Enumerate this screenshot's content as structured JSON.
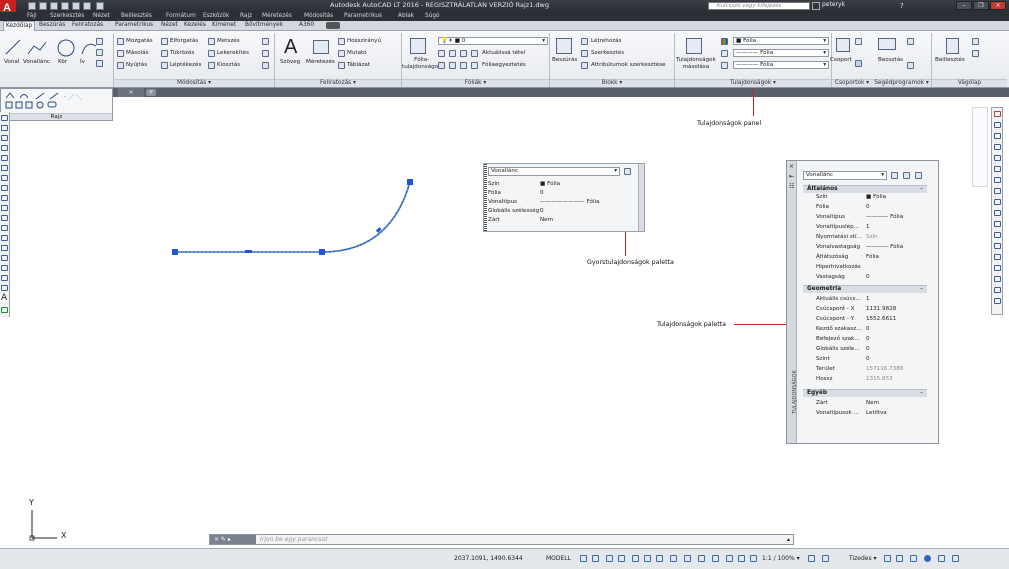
{
  "window": {
    "title": "Autodesk AutoCAD LT 2016 - REGISZTRÁLATLAN VERZIÓ   Rajz1.dwg",
    "app_button": "A",
    "search_placeholder": "Kulcsszó vagy kifejezés",
    "user": "peteryk",
    "minimize": "–",
    "restore": "❐",
    "close": "×"
  },
  "menu": [
    "Fájl",
    "Szerkesztés",
    "Nézet",
    "Beillesztés",
    "Formátum",
    "Eszközök",
    "Rajz",
    "Méretezés",
    "Módosítás",
    "Parametrikus",
    "Ablak",
    "Súgó"
  ],
  "ribbon_tabs": [
    "Kezdőlap",
    "Beszúrás",
    "Feliratozás",
    "Parametrikus",
    "Nézet",
    "Kezelés",
    "Kimenet",
    "Bővítmények",
    "A360"
  ],
  "ribbon": {
    "rajz": {
      "vonal": "Vonal",
      "vonallanc": "Vonallánc",
      "kor": "Kör",
      "iv": "Ív"
    },
    "modositas": {
      "title": "Módosítás",
      "mozgatas": "Mozgatás",
      "elforgatas": "Elforgatás",
      "metszes": "Metszés",
      "masolas": "Másolás",
      "tukrozes": "Tükrözés",
      "lekerekites": "Lekerekítés",
      "nyujtas": "Nyújtás",
      "leptekezes": "Léptékezés",
      "kiosztas": "Kiosztás"
    },
    "feliratozas": {
      "title": "Feliratozás",
      "szoveg": "Szöveg",
      "meretezes": "Méretezés",
      "hosszirany": "Hosszirányú",
      "mutato": "Mutató",
      "tablazat": "Táblázat"
    },
    "foliak": {
      "title": "Fóliák",
      "folia_tul": "Fólia-\ntulajdonságok",
      "current_layer": "0",
      "aktualissa": "Aktuálissá tétel",
      "foliaegy": "Fóliaegyeztetés"
    },
    "blokk": {
      "title": "Blokk",
      "beszuras": "Beszúrás",
      "letrehozas": "Létrehozás",
      "szerkesztes": "Szerkesztés",
      "attributumok": "Attribútumok szerkesztése"
    },
    "tulajdonsagok": {
      "title": "Tulajdonságok",
      "masolas": "Tulajdonságok\nmásolása",
      "color": "Fólia",
      "linetype": "Fólia",
      "lineweight": "Fólia"
    },
    "csoportok": {
      "title": "Csoportok",
      "csoport": "Csoport"
    },
    "segedprogramok": {
      "title": "Segédprogramok",
      "beosztas": "Beosztás"
    },
    "vagolap": {
      "title": "Vágólap",
      "beillesztes": "Beillesztés"
    }
  },
  "rajz_panel_title": "Rajz",
  "doc_tab": "×",
  "doc_tab_plus": "+",
  "quick_props": {
    "type": "Vonallánc",
    "rows": [
      {
        "label": "Szín",
        "value": "Fólia"
      },
      {
        "label": "Fólia",
        "value": "0"
      },
      {
        "label": "Vonaltípus",
        "value": "Fólia"
      },
      {
        "label": "Globális szélesség",
        "value": "0"
      },
      {
        "label": "Zárt",
        "value": "Nem"
      }
    ]
  },
  "properties_palette": {
    "type": "Vonallánc",
    "side_title": "TULAJDONSÁGOK",
    "categories": [
      {
        "name": "Általános",
        "rows": [
          {
            "label": "Szín",
            "value": "Fólia"
          },
          {
            "label": "Fólia",
            "value": "0"
          },
          {
            "label": "Vonaltípus",
            "value": "Fólia"
          },
          {
            "label": "Vonaltípuslép...",
            "value": "1"
          },
          {
            "label": "Nyomtatási stí...",
            "value": "Szín"
          },
          {
            "label": "Vonalvastagság",
            "value": "Fólia"
          },
          {
            "label": "Átlátszóság",
            "value": "Fólia"
          },
          {
            "label": "Hiperhivatkozás",
            "value": ""
          },
          {
            "label": "Vastagság",
            "value": "0"
          }
        ]
      },
      {
        "name": "Geometria",
        "rows": [
          {
            "label": "Aktuális csúcs...",
            "value": "1"
          },
          {
            "label": "Csúcspont - X",
            "value": "1131.9828"
          },
          {
            "label": "Csúcspont - Y",
            "value": "1552.6611"
          },
          {
            "label": "Kezdő szakasz...",
            "value": "0"
          },
          {
            "label": "Befejező szak...",
            "value": "0"
          },
          {
            "label": "Globális széle...",
            "value": "0"
          },
          {
            "label": "Szint",
            "value": "0"
          },
          {
            "label": "Terület",
            "value": "157116.7388"
          },
          {
            "label": "Hossz",
            "value": "1315.853"
          }
        ]
      },
      {
        "name": "Egyéb",
        "rows": [
          {
            "label": "Zárt",
            "value": "Nem"
          },
          {
            "label": "Vonaltípusok ...",
            "value": "Letiltva"
          }
        ]
      }
    ]
  },
  "callouts": {
    "panel": "Tulajdonságok panel",
    "quick": "Gyorstulajdonságok paletta",
    "palette": "Tulajdonságok paletta"
  },
  "command_line": {
    "placeholder": "Írjon be egy parancsot"
  },
  "status": {
    "coords": "2037.1091, 1490.6344",
    "model": "MODELL",
    "scale": "1:1 / 100%",
    "units": "Tizedes"
  },
  "ucs": {
    "x": "X",
    "y": "Y"
  }
}
